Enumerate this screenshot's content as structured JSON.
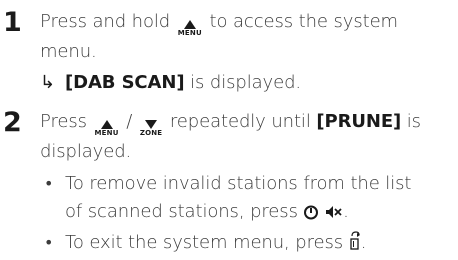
{
  "steps": [
    {
      "number": "1",
      "text_before": "Press and hold",
      "button": "MENU",
      "text_after": "to access the system",
      "text_cont": "menu.",
      "result_bracket": "[DAB SCAN]",
      "result_text": "is displayed."
    },
    {
      "number": "2",
      "text_before": "Press",
      "button_1": "MENU",
      "separator": "/",
      "button_2": "ZONE",
      "text_middle": "repeatedly until",
      "bracket": "[PRUNE]",
      "text_is": "is",
      "text_cont": "displayed.",
      "bullets": [
        {
          "line1": "To remove invalid stations from the list",
          "line2": "of scanned stations, press",
          "icons": [
            "power-icon",
            "mute-icon"
          ],
          "end": "."
        },
        {
          "text": "To exit the system menu, press",
          "icons": [
            "exit-icon"
          ],
          "end": "."
        }
      ]
    }
  ]
}
